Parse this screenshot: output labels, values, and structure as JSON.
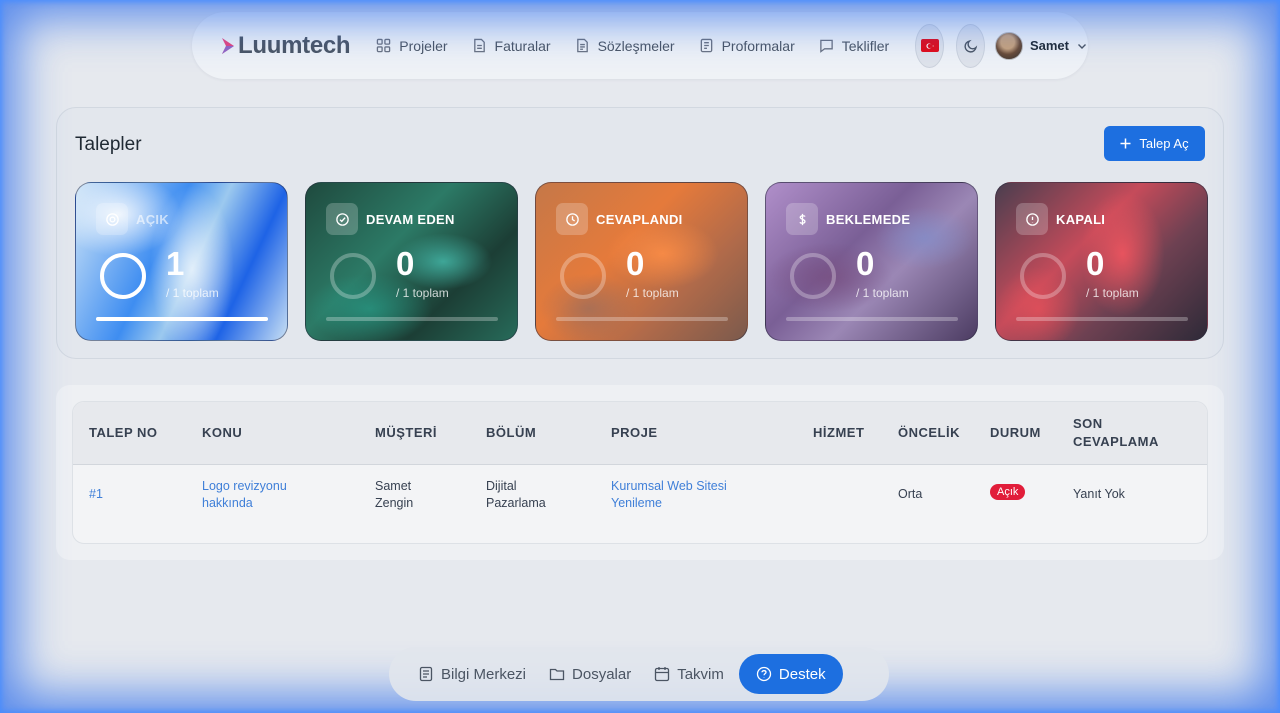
{
  "brand": {
    "name": "Luumtech",
    "accent": "#e8447e"
  },
  "nav": {
    "items": [
      {
        "label": "Projeler",
        "icon": "grid-icon"
      },
      {
        "label": "Faturalar",
        "icon": "document-icon"
      },
      {
        "label": "Sözleşmeler",
        "icon": "contract-icon"
      },
      {
        "label": "Proformalar",
        "icon": "receipt-icon"
      },
      {
        "label": "Teklifler",
        "icon": "chat-icon"
      }
    ],
    "user": {
      "name": "Samet"
    }
  },
  "tickets": {
    "title": "Talepler",
    "add_button": "Talep Aç",
    "cards": [
      {
        "label": "AÇIK",
        "count": "1",
        "total": "/ 1 toplam",
        "progress": 1.0,
        "icon": "target-icon"
      },
      {
        "label": "DEVAM EDEN",
        "count": "0",
        "total": "/ 1 toplam",
        "progress": 0.0,
        "icon": "check-circle-icon"
      },
      {
        "label": "CEVAPLANDI",
        "count": "0",
        "total": "/ 1 toplam",
        "progress": 0.0,
        "icon": "clock-icon"
      },
      {
        "label": "BEKLEMEDE",
        "count": "0",
        "total": "/ 1 toplam",
        "progress": 0.0,
        "icon": "dollar-icon"
      },
      {
        "label": "KAPALI",
        "count": "0",
        "total": "/ 1 toplam",
        "progress": 0.0,
        "icon": "alert-circle-icon"
      }
    ]
  },
  "table": {
    "headers": [
      "TALEP NO",
      "KONU",
      "MÜŞTERİ",
      "BÖLÜM",
      "PROJE",
      "HİZMET",
      "ÖNCELİK",
      "DURUM",
      "SON",
      "CEVAPLAMA"
    ],
    "rows": [
      {
        "no": "#1",
        "subject_1": "Logo revizyonu",
        "subject_2": "hakkında",
        "customer_1": "Samet",
        "customer_2": "Zengin",
        "department_1": "Dijital",
        "department_2": "Pazarlama",
        "project_1": "Kurumsal Web Sitesi",
        "project_2": "Yenileme",
        "service": "",
        "priority": "Orta",
        "status": "Açık",
        "last_reply": "Yanıt Yok"
      }
    ]
  },
  "dock": {
    "items": [
      {
        "label": "Bilgi Merkezi",
        "icon": "book-icon"
      },
      {
        "label": "Dosyalar",
        "icon": "folder-icon"
      },
      {
        "label": "Takvim",
        "icon": "calendar-icon"
      },
      {
        "label": "Destek",
        "icon": "help-circle-icon"
      }
    ]
  }
}
